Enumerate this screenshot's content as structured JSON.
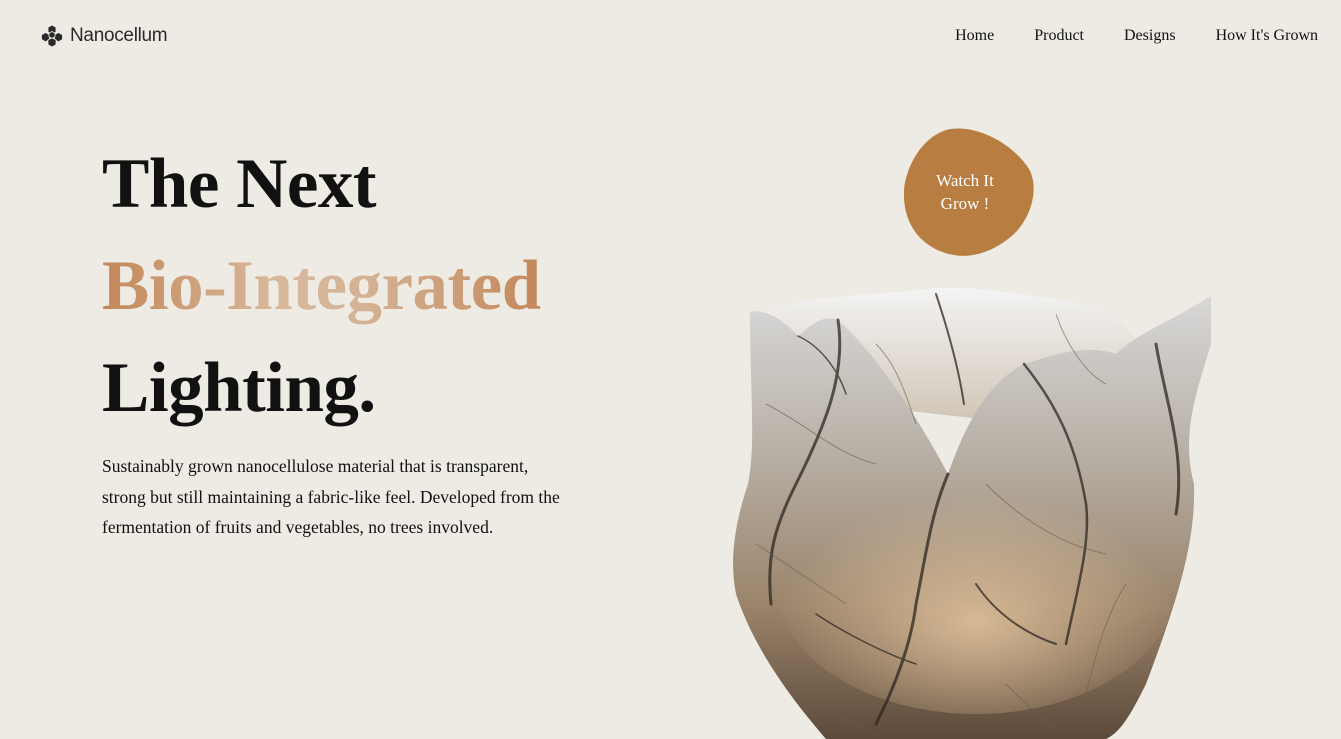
{
  "brand": {
    "name": "Nanocellum",
    "icon": "hexagon-cluster-icon"
  },
  "nav": {
    "items": [
      "Home",
      "Product",
      "Designs",
      "How It's Grown"
    ]
  },
  "hero": {
    "line1": "The Next",
    "line2": "Bio-Integrated",
    "line3": "Lighting.",
    "description": "Sustainably grown nanocellulose material that is transparent, strong but still maintaining a fabric-like feel. Developed from the fermentation of fruits and vegetables, no trees involved."
  },
  "cta": {
    "line1": "Watch It",
    "line2": "Grow !"
  },
  "colors": {
    "background": "#eeebe5",
    "accent": "#b87d41",
    "gradient_start": "#c3885a",
    "gradient_mid": "#d9b89c"
  }
}
